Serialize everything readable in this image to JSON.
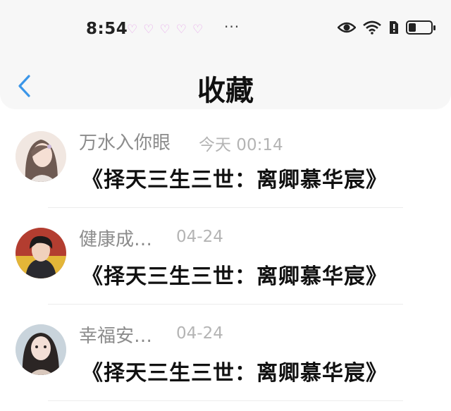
{
  "status_bar": {
    "time": "8:54",
    "hearts": [
      "♡",
      "♡",
      "♡",
      "♡",
      "♡"
    ],
    "more": "···",
    "heart_color": "#e7a8ea"
  },
  "header": {
    "title": "收藏",
    "back_icon": "chevron-left-icon",
    "accent": "#3b96e8"
  },
  "favorites": [
    {
      "username": "万水入你眼",
      "date": "今天 00:14",
      "title": "《择天三生三世：离卿慕华宸》"
    },
    {
      "username": "健康成…",
      "date": "04-24",
      "title": "《择天三生三世：离卿慕华宸》"
    },
    {
      "username": "幸福安…",
      "date": "04-24",
      "title": "《择天三生三世：离卿慕华宸》"
    }
  ]
}
